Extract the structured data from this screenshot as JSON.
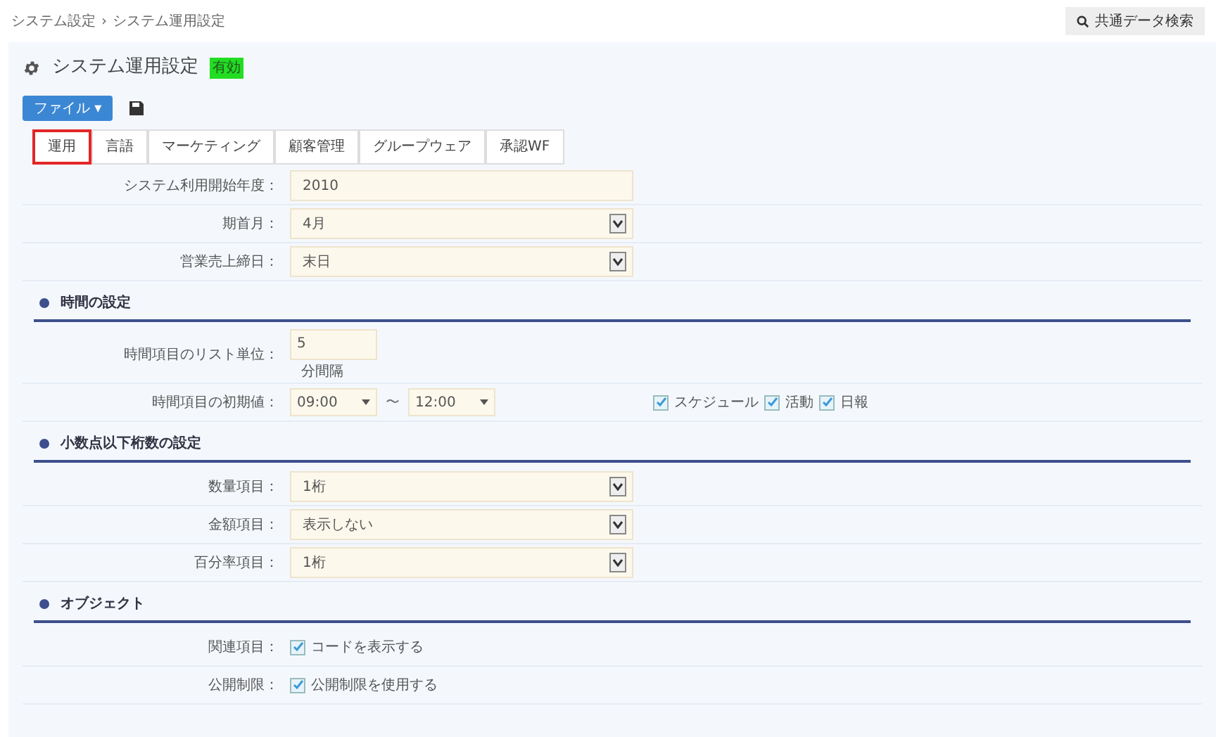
{
  "breadcrumb": [
    "システム設定",
    "›",
    "システム運用設定"
  ],
  "search_button": {
    "label": "共通データ検索"
  },
  "title": "システム運用設定",
  "badge": "有効",
  "file_button": {
    "label": "ファイル ▾"
  },
  "tabs": [
    {
      "label": "運用",
      "selected": true
    },
    {
      "label": "言語",
      "selected": false
    },
    {
      "label": "マーケティング",
      "selected": false
    },
    {
      "label": "顧客管理",
      "selected": false
    },
    {
      "label": "グループウェア",
      "selected": false
    },
    {
      "label": "承認WF",
      "selected": false
    }
  ],
  "sections": [
    {
      "rows": [
        {
          "kind": "text",
          "label": "システム利用開始年度：",
          "value": "2010"
        },
        {
          "kind": "select",
          "label": "期首月：",
          "value": "4月"
        },
        {
          "kind": "select",
          "label": "営業売上締日：",
          "value": "末日"
        }
      ]
    },
    {
      "title": "時間の設定",
      "rows": [
        {
          "kind": "short",
          "label": "時間項目のリスト単位：",
          "value": "5",
          "note": "分間隔"
        },
        {
          "kind": "timerange",
          "label": "時間項目の初期値：",
          "from": "09:00",
          "sep": "〜",
          "to": "12:00",
          "checks": [
            {
              "label": "スケジュール",
              "checked": true
            },
            {
              "label": "活動",
              "checked": true
            },
            {
              "label": "日報",
              "checked": true
            }
          ]
        }
      ]
    },
    {
      "title": "小数点以下桁数の設定",
      "rows": [
        {
          "kind": "select",
          "label": "数量項目：",
          "value": "1桁"
        },
        {
          "kind": "select",
          "label": "金額項目：",
          "value": "表示しない"
        },
        {
          "kind": "select",
          "label": "百分率項目：",
          "value": "1桁"
        }
      ]
    },
    {
      "title": "オブジェクト",
      "rows": [
        {
          "kind": "check",
          "label": "関連項目：",
          "checks": [
            {
              "label": "コードを表示する",
              "checked": true
            }
          ]
        },
        {
          "kind": "check",
          "label": "公開制限：",
          "checks": [
            {
              "label": "公開制限を使用する",
              "checked": true
            }
          ]
        }
      ]
    }
  ]
}
